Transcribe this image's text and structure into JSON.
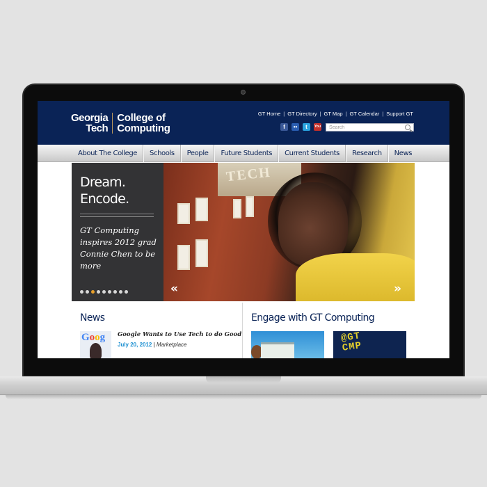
{
  "header": {
    "logo_gt_line1": "Georgia",
    "logo_gt_line2": "Tech",
    "logo_coc_line1": "College of",
    "logo_coc_line2": "Computing",
    "util_links": [
      "GT Home",
      "GT Directory",
      "GT Map",
      "GT Calendar",
      "Support GT"
    ],
    "social_icons": [
      {
        "name": "facebook-icon",
        "glyph": "f",
        "color": "#3b5998"
      },
      {
        "name": "flickr-icon",
        "glyph": "••",
        "color": "#2a5db0"
      },
      {
        "name": "twitter-icon",
        "glyph": "t",
        "color": "#2aa4e0"
      },
      {
        "name": "youtube-icon",
        "glyph": "You",
        "color": "#c4302b"
      }
    ],
    "search_placeholder": "Search",
    "brand_color": "#0a2356"
  },
  "nav": {
    "items": [
      "About The College",
      "Schools",
      "People",
      "Future Students",
      "Current Students",
      "Research",
      "News"
    ]
  },
  "hero": {
    "headline_line1": "Dream.",
    "headline_line2": "Encode.",
    "caption": "GT Computing inspires 2012 grad Connie Chen to be more",
    "building_text": "TECH",
    "dot_count": 9,
    "active_dot": 2,
    "prev_arrow": "«",
    "next_arrow": "»"
  },
  "news": {
    "title": "News",
    "item": {
      "headline": "Google Wants to Use Tech to do Good",
      "date": "July 20, 2012",
      "separator": " | ",
      "source": "Marketplace",
      "thumb_text": "Goog"
    }
  },
  "engage": {
    "title": "Engage with GT Computing",
    "badge_text_line1": "@GT",
    "badge_text_line2": "CMP"
  }
}
